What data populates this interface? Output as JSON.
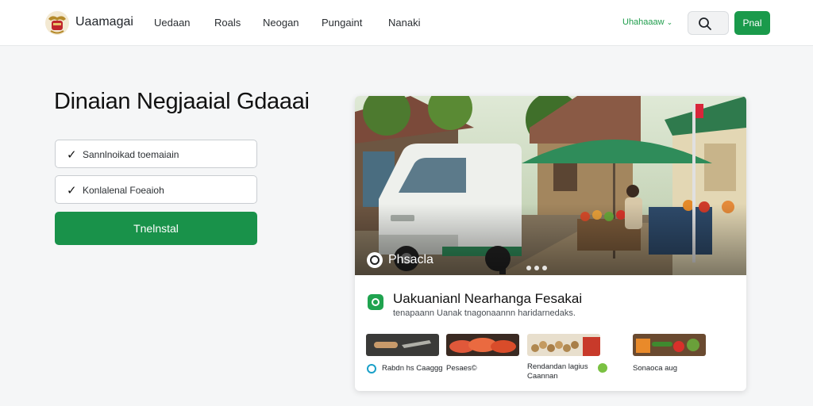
{
  "header": {
    "brand": "Uaamagai",
    "nav": [
      "Uedaan",
      "Roals",
      "Neogan",
      "Pungaint",
      "Nanaki"
    ],
    "language": "Uhahaaaw",
    "cta_label": "Pnal"
  },
  "hero": {
    "title": "Dinaian Negjaaial Gdaaai",
    "checks": [
      "Sannlnoikad toemaiain",
      "Konlalenal Foeaioh"
    ],
    "primary_button": "Tnelnstal"
  },
  "card": {
    "photo_caption": "Phsacla",
    "info_title": "Uakuanianl Nearhanga Fesakai",
    "info_subtitle": "tenapaann  Uanak  tnagonaannn  haridarnedaks.",
    "thumbs": [
      {
        "label": "Rabdn hs Caaggg",
        "icon_color": "#1aa0c8"
      },
      {
        "label": "Pesaes©",
        "icon_color": "#1aa04b"
      },
      {
        "label": "Rendandan lagius\nCaannan",
        "icon_color": "#7ac142"
      },
      {
        "label": "Sonaoca aug",
        "icon_color": "#1aa04b"
      }
    ]
  },
  "colors": {
    "accent_green": "#1a9a4b",
    "background": "#f5f6f7"
  }
}
